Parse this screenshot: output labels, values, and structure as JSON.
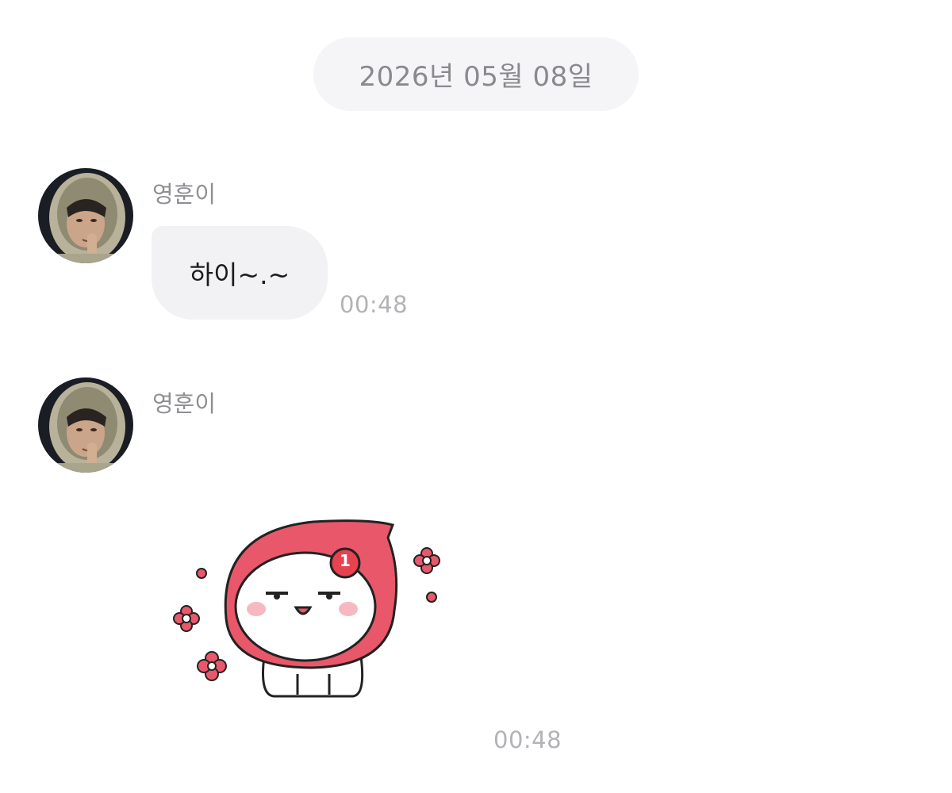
{
  "chat": {
    "date_divider": "2026년 05월 08일",
    "messages": [
      {
        "sender": "영훈이",
        "text": "하이~.~",
        "time": "00:48"
      },
      {
        "sender": "영훈이",
        "type": "sticker",
        "sticker_badge": "1",
        "time": "00:48"
      }
    ]
  },
  "colors": {
    "date_pill_bg": "#f5f5f7",
    "bubble_bg": "#f2f2f4",
    "sticker_red": "#e8586a",
    "time_text": "#b3b3b7"
  }
}
